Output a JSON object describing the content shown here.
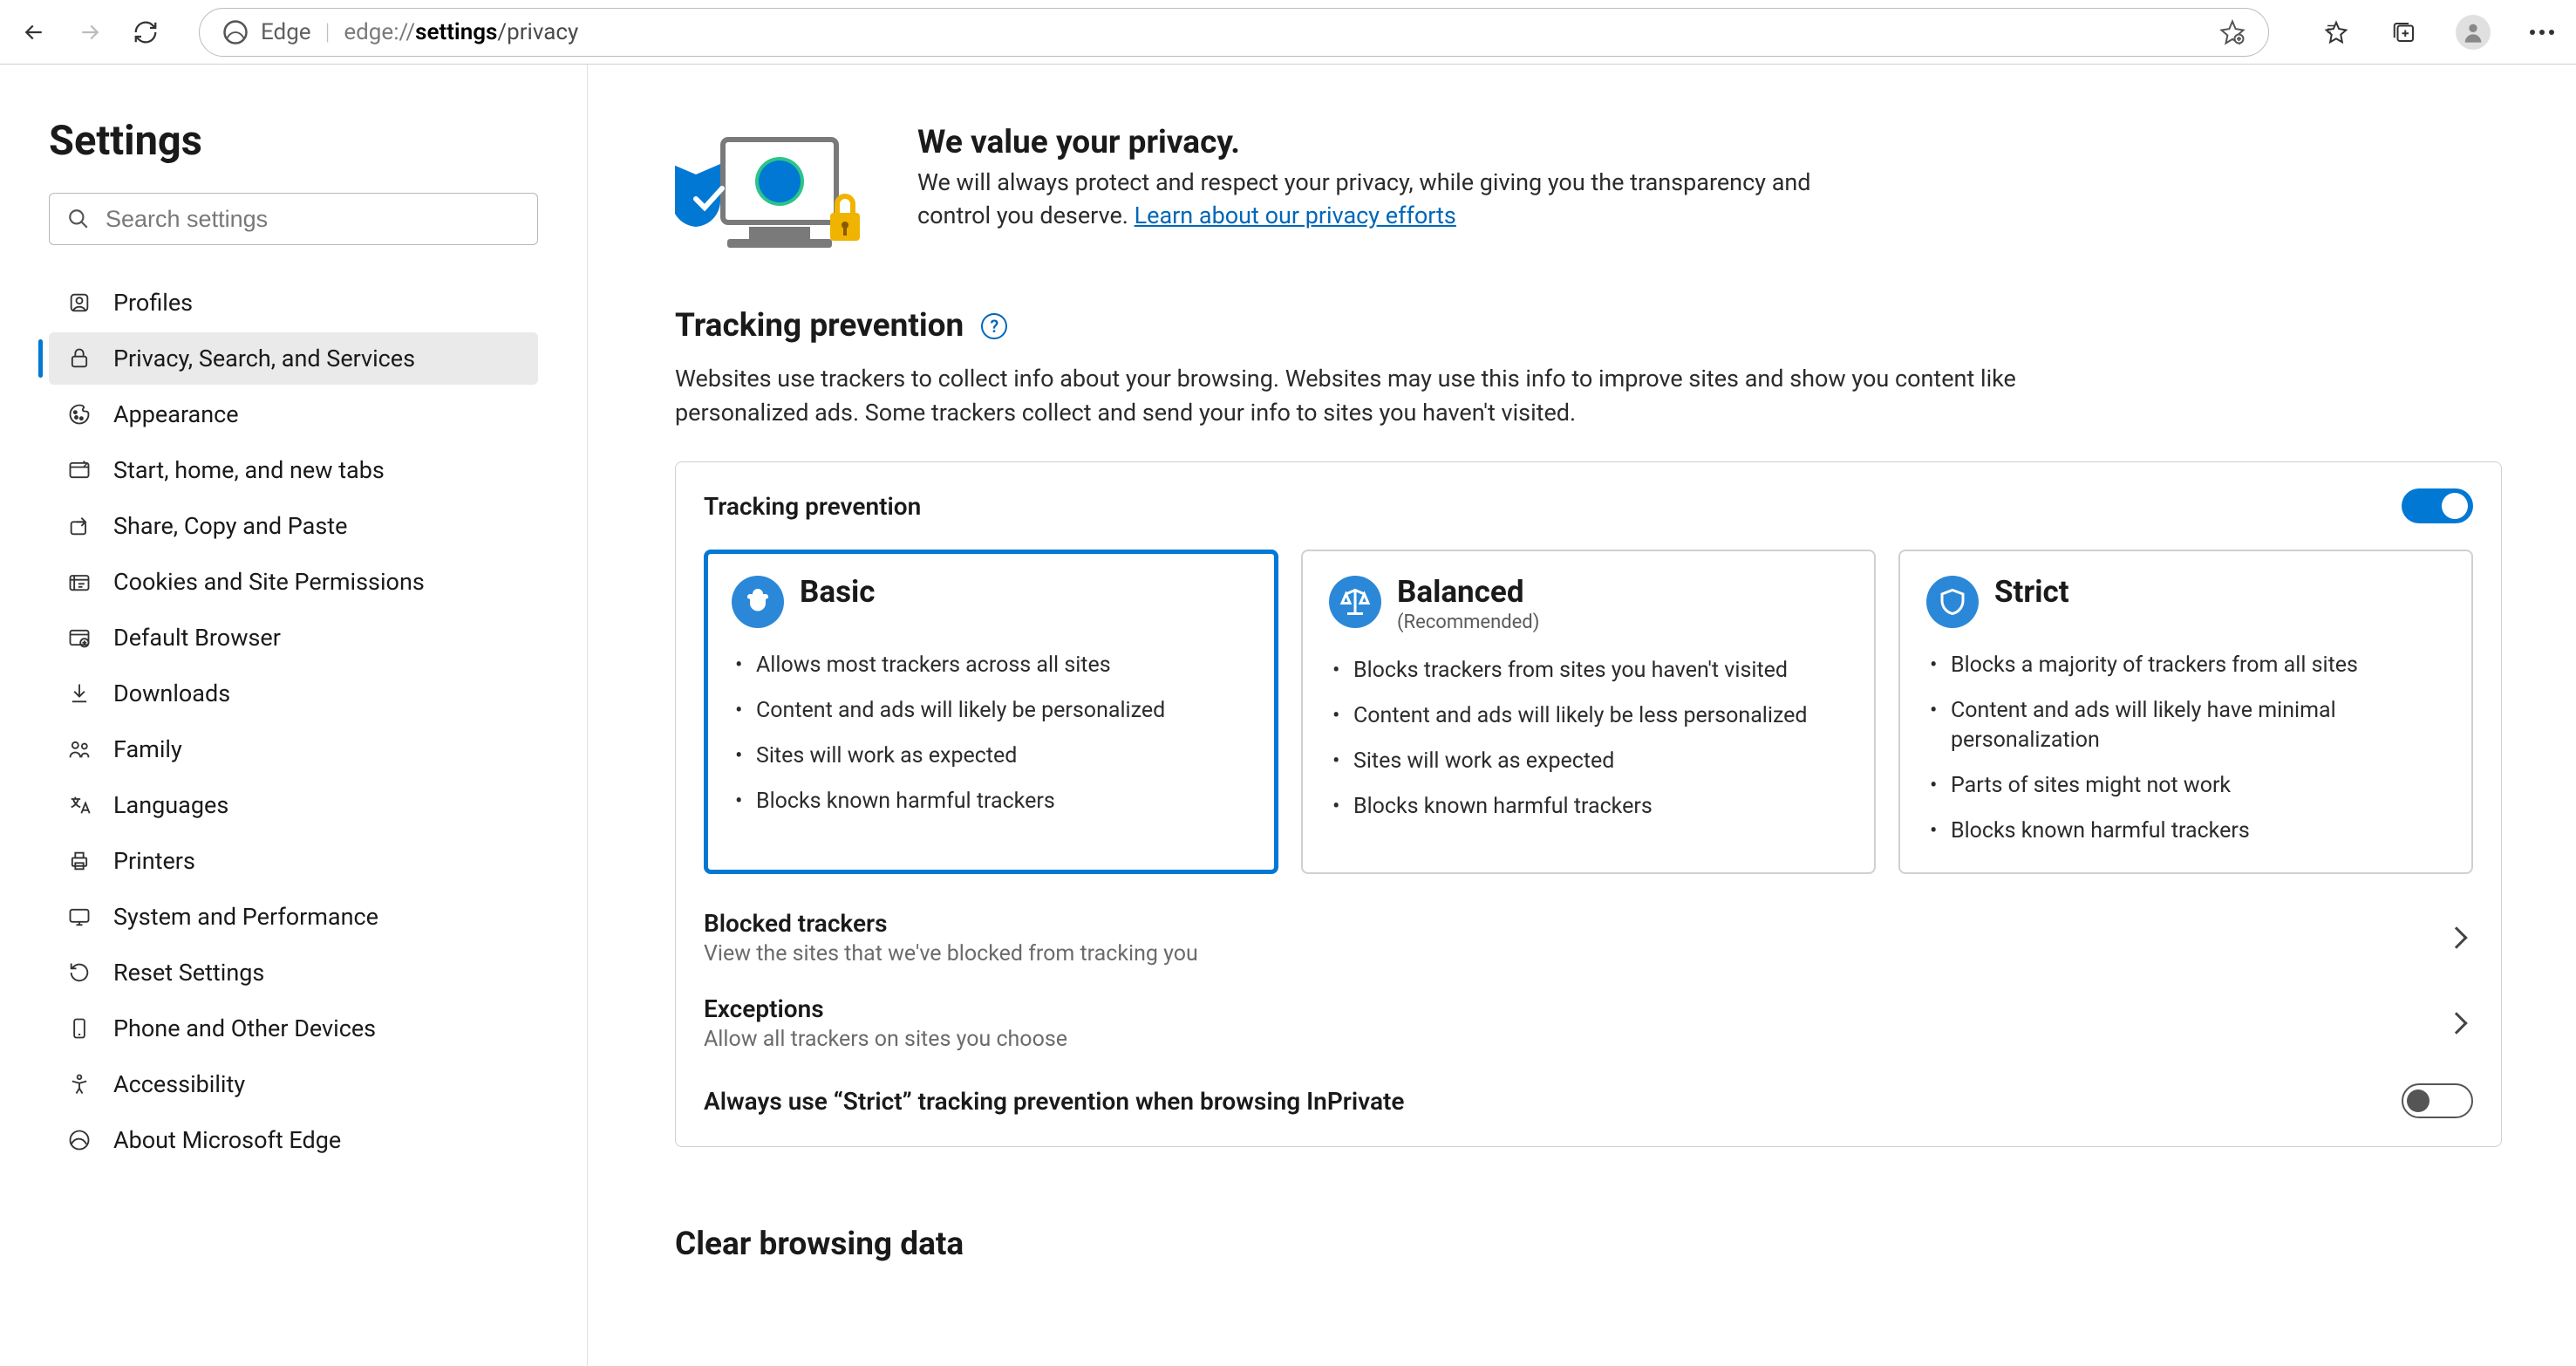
{
  "address_bar": {
    "app_name": "Edge",
    "url_prefix": "edge://",
    "url_bold": "settings",
    "url_suffix": "/privacy"
  },
  "sidebar": {
    "title": "Settings",
    "search_placeholder": "Search settings",
    "items": [
      {
        "label": "Profiles",
        "icon": "profiles-icon"
      },
      {
        "label": "Privacy, Search, and Services",
        "icon": "lock-icon"
      },
      {
        "label": "Appearance",
        "icon": "appearance-icon"
      },
      {
        "label": "Start, home, and new tabs",
        "icon": "new-tab-icon"
      },
      {
        "label": "Share, Copy and Paste",
        "icon": "share-icon"
      },
      {
        "label": "Cookies and Site Permissions",
        "icon": "cookies-icon"
      },
      {
        "label": "Default Browser",
        "icon": "default-browser-icon"
      },
      {
        "label": "Downloads",
        "icon": "download-icon"
      },
      {
        "label": "Family",
        "icon": "family-icon"
      },
      {
        "label": "Languages",
        "icon": "languages-icon"
      },
      {
        "label": "Printers",
        "icon": "printer-icon"
      },
      {
        "label": "System and Performance",
        "icon": "system-icon"
      },
      {
        "label": "Reset Settings",
        "icon": "reset-icon"
      },
      {
        "label": "Phone and Other Devices",
        "icon": "phone-icon"
      },
      {
        "label": "Accessibility",
        "icon": "accessibility-icon"
      },
      {
        "label": "About Microsoft Edge",
        "icon": "edge-icon"
      }
    ],
    "active_index": 1
  },
  "privacy_header": {
    "title": "We value your privacy.",
    "text": "We will always protect and respect your privacy, while giving you the transparency and control you deserve. ",
    "link": "Learn about our privacy efforts"
  },
  "tracking": {
    "heading": "Tracking prevention",
    "description": "Websites use trackers to collect info about your browsing. Websites may use this info to improve sites and show you content like personalized ads. Some trackers collect and send your info to sites you haven't visited.",
    "card_title": "Tracking prevention",
    "master_toggle_on": true,
    "selected_index": 0,
    "options": [
      {
        "name": "Basic",
        "subtitle": "",
        "bullets": [
          "Allows most trackers across all sites",
          "Content and ads will likely be personalized",
          "Sites will work as expected",
          "Blocks known harmful trackers"
        ]
      },
      {
        "name": "Balanced",
        "subtitle": "(Recommended)",
        "bullets": [
          "Blocks trackers from sites you haven't visited",
          "Content and ads will likely be less personalized",
          "Sites will work as expected",
          "Blocks known harmful trackers"
        ]
      },
      {
        "name": "Strict",
        "subtitle": "",
        "bullets": [
          "Blocks a majority of trackers from all sites",
          "Content and ads will likely have minimal personalization",
          "Parts of sites might not work",
          "Blocks known harmful trackers"
        ]
      }
    ],
    "blocked": {
      "title": "Blocked trackers",
      "sub": "View the sites that we've blocked from tracking you"
    },
    "exceptions": {
      "title": "Exceptions",
      "sub": "Allow all trackers on sites you choose"
    },
    "strict_inprivate": {
      "title": "Always use “Strict” tracking prevention when browsing InPrivate",
      "on": false
    }
  },
  "clear_browsing_data": {
    "heading": "Clear browsing data"
  }
}
